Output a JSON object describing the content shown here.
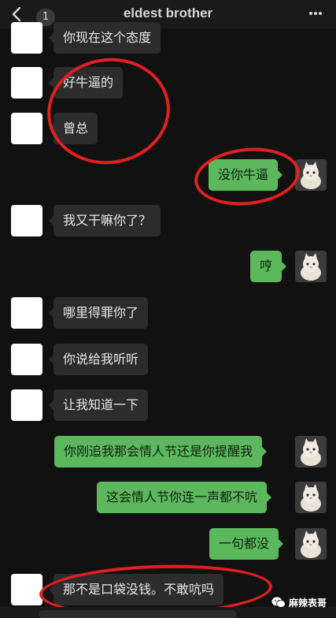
{
  "header": {
    "back_icon": "chevron-left-icon",
    "unread_count": "1",
    "title": "eldest brother",
    "more_icon": "more-dots-icon"
  },
  "messages": [
    {
      "side": "in",
      "text": "你现在这个态度"
    },
    {
      "side": "in",
      "text": "好牛逼的"
    },
    {
      "side": "in",
      "text": "曾总"
    },
    {
      "side": "out",
      "text": "没你牛逼"
    },
    {
      "side": "in",
      "text": "我又干嘛你了？"
    },
    {
      "side": "out",
      "text": "哼"
    },
    {
      "side": "in",
      "text": "哪里得罪你了"
    },
    {
      "side": "in",
      "text": "你说给我听听"
    },
    {
      "side": "in",
      "text": "让我知道一下"
    },
    {
      "side": "out",
      "text": "你刚追我那会情人节还是你提醒我"
    },
    {
      "side": "out",
      "text": "这会情人节你连一声都不吭"
    },
    {
      "side": "out",
      "text": "一句都没"
    },
    {
      "side": "in",
      "text": "那不是口袋没钱。不敢吭吗"
    }
  ],
  "watermark": {
    "text": "麻辣表哥",
    "icon": "wechat-logo-icon"
  },
  "colors": {
    "background": "#111111",
    "outgoing": "#5cb85c",
    "incoming": "#2c2c2c",
    "annotation": "#e02020"
  }
}
